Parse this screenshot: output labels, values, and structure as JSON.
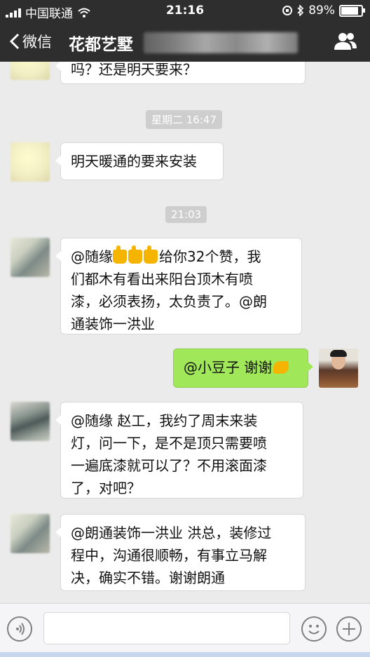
{
  "status_bar": {
    "carrier": "中国联通",
    "time": "21:16",
    "battery": "89%",
    "battery_level": 0.89
  },
  "nav": {
    "back_label": "微信",
    "title": "花都艺墅",
    "people_icon": "people-icon"
  },
  "chat": {
    "messages": [
      {
        "side": "left",
        "text": "吗？还是明天要来？"
      },
      {
        "type": "time",
        "text": "星期二 16:47"
      },
      {
        "side": "left",
        "text": "明天暖通的要来安装"
      },
      {
        "type": "time",
        "text": "21:03"
      },
      {
        "side": "left",
        "text_a": "@随缘",
        "text_b": "给你32个赞，我\n们都木有看出来阳台顶木有喷\n漆，必须表扬，太负责了。@朗\n通装饰一洪业"
      },
      {
        "side": "right",
        "text": "@小豆子 谢谢"
      },
      {
        "side": "left",
        "text": "@随缘 赵工，我约了周末来装\n灯，问一下，是不是顶只需要喷\n一遍底漆就可以了？不用滚面漆\n了，对吧？"
      },
      {
        "side": "left",
        "text": "@朗通装饰一洪业 洪总，装修过\n程中，沟通很顺畅，有事立马解\n决，确实不错。谢谢朗通"
      }
    ]
  },
  "input_bar": {
    "voice_icon": "voice-icon",
    "emoji_icon": "emoji-icon",
    "plus_icon": "plus-icon"
  },
  "colors": {
    "nav_bg": "#2e2e2e",
    "chat_bg": "#ebebeb",
    "green_bubble": "#a0e759"
  }
}
